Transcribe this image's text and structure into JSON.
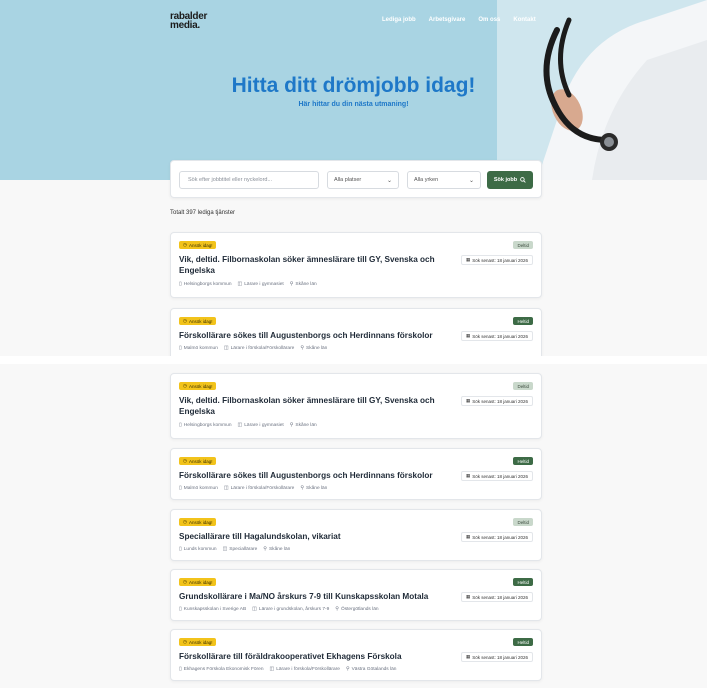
{
  "brand": {
    "logo_line1": "rabalder",
    "logo_line2": "media."
  },
  "nav": [
    "Lediga jobb",
    "Arbetsgivare",
    "Om oss",
    "Kontakt"
  ],
  "hero": {
    "title": "Hitta ditt drömjobb idag!",
    "subtitle": "Här hittar du din nästa utmaning!"
  },
  "search": {
    "placeholder": "Sök efter jobbtitel eller nyckelord...",
    "places_value": "Alla platser",
    "jobs_value": "Alla yrken",
    "button_label": "Sök jobb"
  },
  "total_text": "Totalt 397 lediga tjänster",
  "jobs": [
    {
      "urgent": "Ansök idag!",
      "type": "Deltid",
      "title": "Vik, deltid. Filbornaskolan söker ämneslärare till GY, Svenska och Engelska",
      "deadline": "Sök senast: 18 januari 2026",
      "employer": "Helsingborgs kommun",
      "category": "Lärare i gymnasiet",
      "location": "Skåne län"
    },
    {
      "urgent": "Ansök idag!",
      "type": "Heltid",
      "title": "Förskollärare sökes till Augustenborgs och Herdinnans förskolor",
      "deadline": "Sök senast: 18 januari 2026",
      "employer": "Malmö kommun",
      "category": "Lärare i förskola/Förskollärare",
      "location": "Skåne län"
    },
    {
      "urgent": "Ansök idag!",
      "type": "Deltid",
      "title": "Speciallärare till Hagalundskolan, vikariat",
      "deadline": "Sök senast: 18 januari 2026",
      "employer": "Lunds kommun",
      "category": "Speciallärare",
      "location": "Skåne län"
    },
    {
      "urgent": "Ansök idag!",
      "type": "Heltid",
      "title": "Grundskollärare i Ma/NO årskurs 7-9 till Kunskapsskolan Motala",
      "deadline": "Sök senast: 18 januari 2026",
      "employer": "Kunskapsskolan i Sverige AB",
      "category": "Lärare i grundskolan, årskurs 7-9",
      "location": "Östergötlands län"
    },
    {
      "urgent": "Ansök idag!",
      "type": "Heltid",
      "title": "Förskollärare till föräldrakooperativet Ekhagens Förskola",
      "deadline": "Sök senast: 18 januari 2026",
      "employer": "Ekhagens Förskola Ekonomisk Fören",
      "category": "Lärare i förskola/Förskollärare",
      "location": "Västra Götalands län"
    }
  ],
  "colors": {
    "hero_bg": "#a9d4e3",
    "title_blue": "#1e78c8",
    "brand_green": "#3d6b46",
    "urgent_yellow": "#f2c31b"
  }
}
